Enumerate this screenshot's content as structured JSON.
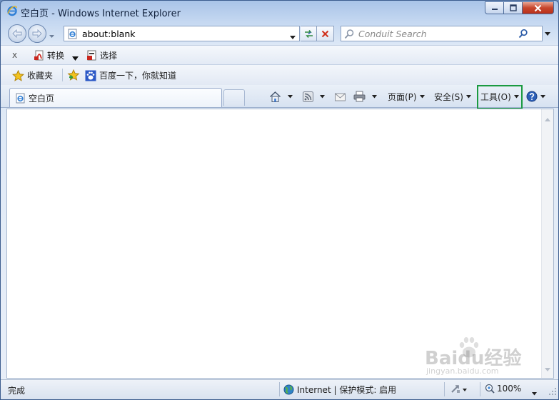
{
  "window": {
    "title": "空白页 - Windows Internet Explorer",
    "accent_color": "#1a9a40"
  },
  "navigation": {
    "address_value": "about:blank",
    "search_placeholder": "Conduit Search"
  },
  "command_bar": {
    "close_label": "x",
    "convert_label": "转换",
    "select_label": "选择"
  },
  "favorites_bar": {
    "favorites_label": "收藏夹",
    "link_label": "百度一下，你就知道"
  },
  "tabs": [
    {
      "label": "空白页",
      "active": true
    }
  ],
  "toolbar": {
    "page_label": "页面(P)",
    "safety_label": "安全(S)",
    "tools_label": "工具(O)"
  },
  "status_bar": {
    "status_text": "完成",
    "zone_text": "Internet | 保护模式: 启用",
    "zoom_text": "100%"
  },
  "watermark": {
    "text_main": "Baidu经验",
    "text_sub": "jingyan.baidu.com"
  }
}
